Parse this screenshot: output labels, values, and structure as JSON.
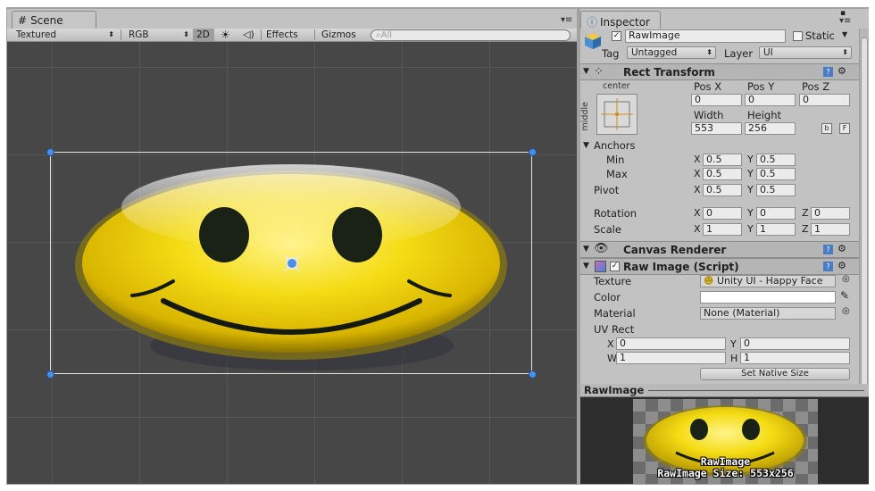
{
  "scene": {
    "tab_label": "Scene",
    "tab_icon": "grid-icon",
    "panel_menu": "▾≡",
    "toolbar": {
      "draw_mode": "Textured",
      "render_mode": "RGB",
      "toggle_2d": "2D",
      "lighting_icon": "sun-icon",
      "audio_icon": "speaker-icon",
      "effects": "Effects",
      "gizmos": "Gizmos",
      "search_placeholder": "All"
    }
  },
  "inspector": {
    "tab_label": "Inspector",
    "tab_icon": "info-icon",
    "object_name": "RawImage",
    "static_label": "Static",
    "tag_label": "Tag",
    "tag_value": "Untagged",
    "layer_label": "Layer",
    "layer_value": "UI",
    "rect_transform": {
      "title": "Rect Transform",
      "anchor_preset_top": "center",
      "anchor_preset_side": "middle",
      "pos_x_label": "Pos X",
      "pos_y_label": "Pos Y",
      "pos_z_label": "Pos Z",
      "pos_x": "0",
      "pos_y": "0",
      "pos_z": "0",
      "width_label": "Width",
      "height_label": "Height",
      "width": "553",
      "height": "256",
      "blueprint_btn": "b",
      "raw_btn": "F",
      "anchors_label": "Anchors",
      "min_label": "Min",
      "max_label": "Max",
      "min_x": "0.5",
      "min_y": "0.5",
      "max_x": "0.5",
      "max_y": "0.5",
      "pivot_label": "Pivot",
      "pivot_x": "0.5",
      "pivot_y": "0.5",
      "rotation_label": "Rotation",
      "rot_x": "0",
      "rot_y": "0",
      "rot_z": "0",
      "scale_label": "Scale",
      "scale_x": "1",
      "scale_y": "1",
      "scale_z": "1",
      "x": "X",
      "y": "Y",
      "z": "Z"
    },
    "canvas_renderer": {
      "title": "Canvas Renderer"
    },
    "raw_image": {
      "title": "Raw Image (Script)",
      "texture_label": "Texture",
      "texture_value": "Unity UI - Happy Face",
      "color_label": "Color",
      "color_value": "#ffffff",
      "material_label": "Material",
      "material_value": "None (Material)",
      "uv_rect_label": "UV Rect",
      "uv_x": "0",
      "uv_y": "0",
      "uv_w": "1",
      "uv_h": "1",
      "w": "W",
      "h": "H",
      "set_native_size": "Set Native Size"
    }
  },
  "preview": {
    "title": "RawImage",
    "caption_name": "RawImage",
    "caption_size": "RawImage Size: 553x256"
  },
  "colors": {
    "accent": "#4b8fe0",
    "face_yellow": "#f0d000"
  }
}
